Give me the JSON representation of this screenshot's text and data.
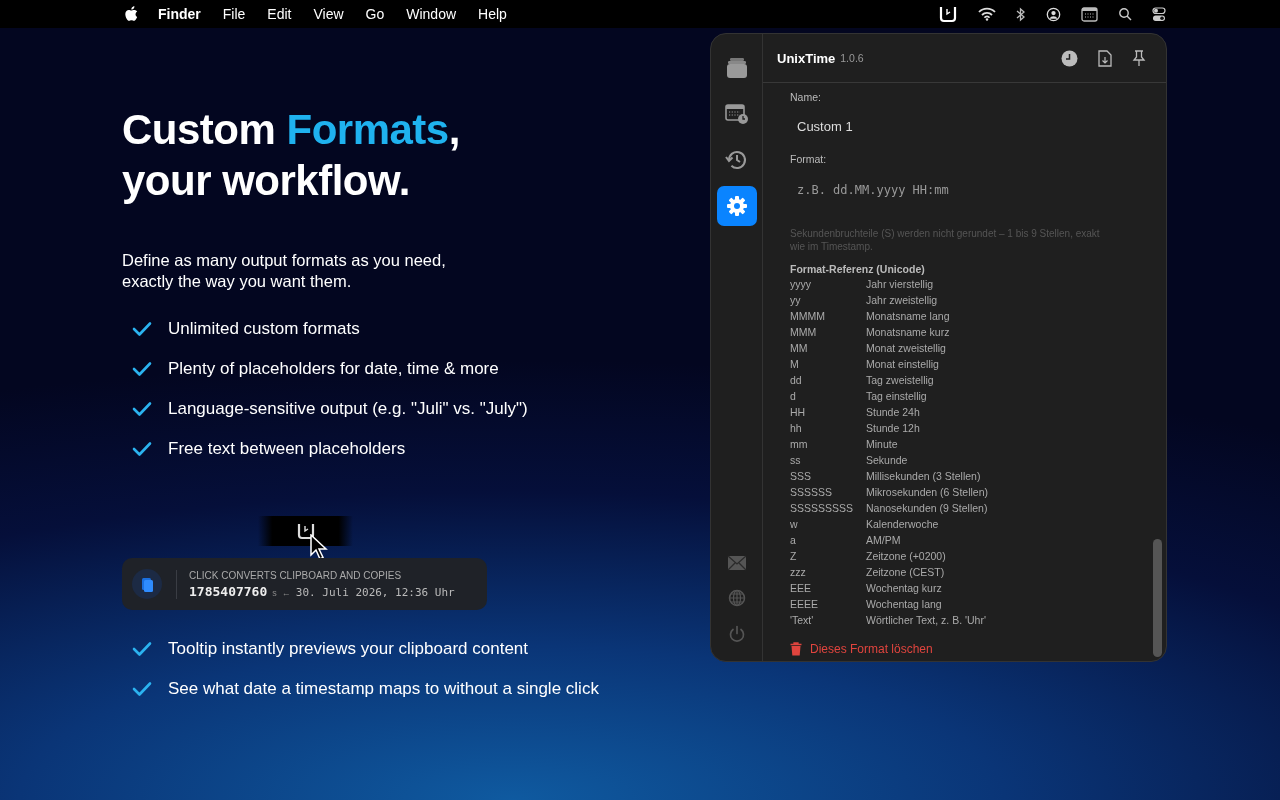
{
  "menu_bar": {
    "app": "Finder",
    "items": [
      "File",
      "Edit",
      "View",
      "Go",
      "Window",
      "Help"
    ]
  },
  "hero": {
    "headline": [
      [
        {
          "text": "Custom ",
          "highlight": false
        },
        {
          "text": "Formats",
          "highlight": true
        },
        {
          "text": ",",
          "highlight": false
        }
      ],
      [
        {
          "text": "your workflow.",
          "highlight": false
        }
      ]
    ],
    "intro": [
      "Define as many output formats as you need,",
      "exactly the way you want them."
    ],
    "features": [
      "Unlimited custom formats",
      "Plenty of placeholders for date, time & more",
      "Language-sensitive output (e.g. \"Juli\" vs. \"July\")",
      "Free text between placeholders"
    ],
    "tooltip": {
      "caption": "CLICK CONVERTS CLIPBOARD AND COPIES",
      "timestamp": "1785407760",
      "unit": "s",
      "arrow": "←",
      "date": "30. Juli 2026, 12:36 Uhr"
    },
    "features_2": [
      "Tooltip instantly previews your clipboard content",
      "See what date a timestamp maps to without a single click"
    ]
  },
  "app_window": {
    "title": "UnixTime",
    "version": "1.0.6",
    "nav": [
      {
        "kind": "stack",
        "selected": false
      },
      {
        "kind": "calendar",
        "selected": false
      },
      {
        "kind": "history",
        "selected": false
      },
      {
        "kind": "gear",
        "selected": true
      }
    ],
    "nav_bottom": [
      {
        "kind": "mail"
      },
      {
        "kind": "globe"
      },
      {
        "kind": "power"
      }
    ],
    "name_label": "Name:",
    "name_value": "Custom 1",
    "format_label": "Format:",
    "format_placeholder": "z.B. dd.MM.yyyy HH:mm",
    "hint": "Sekundenbruchteile (S) werden nicht gerundet – 1 bis 9 Stellen, exakt wie im Timestamp.",
    "reference_title": "Format-Referenz (Unicode)",
    "reference": [
      {
        "code": "yyyy",
        "meaning": "Jahr vierstellig"
      },
      {
        "code": "yy",
        "meaning": "Jahr zweistellig"
      },
      {
        "code": "MMMM",
        "meaning": "Monatsname lang"
      },
      {
        "code": "MMM",
        "meaning": "Monatsname kurz"
      },
      {
        "code": "MM",
        "meaning": "Monat zweistellig"
      },
      {
        "code": "M",
        "meaning": "Monat einstellig"
      },
      {
        "code": "dd",
        "meaning": "Tag zweistellig"
      },
      {
        "code": "d",
        "meaning": "Tag einstellig"
      },
      {
        "code": "HH",
        "meaning": "Stunde 24h"
      },
      {
        "code": "hh",
        "meaning": "Stunde 12h"
      },
      {
        "code": "mm",
        "meaning": "Minute"
      },
      {
        "code": "ss",
        "meaning": "Sekunde"
      },
      {
        "code": "SSS",
        "meaning": "Millisekunden (3 Stellen)"
      },
      {
        "code": "SSSSSS",
        "meaning": "Mikrosekunden (6 Stellen)"
      },
      {
        "code": "SSSSSSSSS",
        "meaning": "Nanosekunden (9 Stellen)"
      },
      {
        "code": "w",
        "meaning": "Kalenderwoche"
      },
      {
        "code": "a",
        "meaning": "AM/PM"
      },
      {
        "code": "Z",
        "meaning": "Zeitzone (+0200)"
      },
      {
        "code": "zzz",
        "meaning": "Zeitzone (CEST)"
      },
      {
        "code": "EEE",
        "meaning": "Wochentag kurz"
      },
      {
        "code": "EEEE",
        "meaning": "Wochentag lang"
      },
      {
        "code": "'Text'",
        "meaning": "Wörtlicher Text, z. B. 'Uhr'"
      }
    ],
    "delete": "Dieses Format löschen"
  }
}
